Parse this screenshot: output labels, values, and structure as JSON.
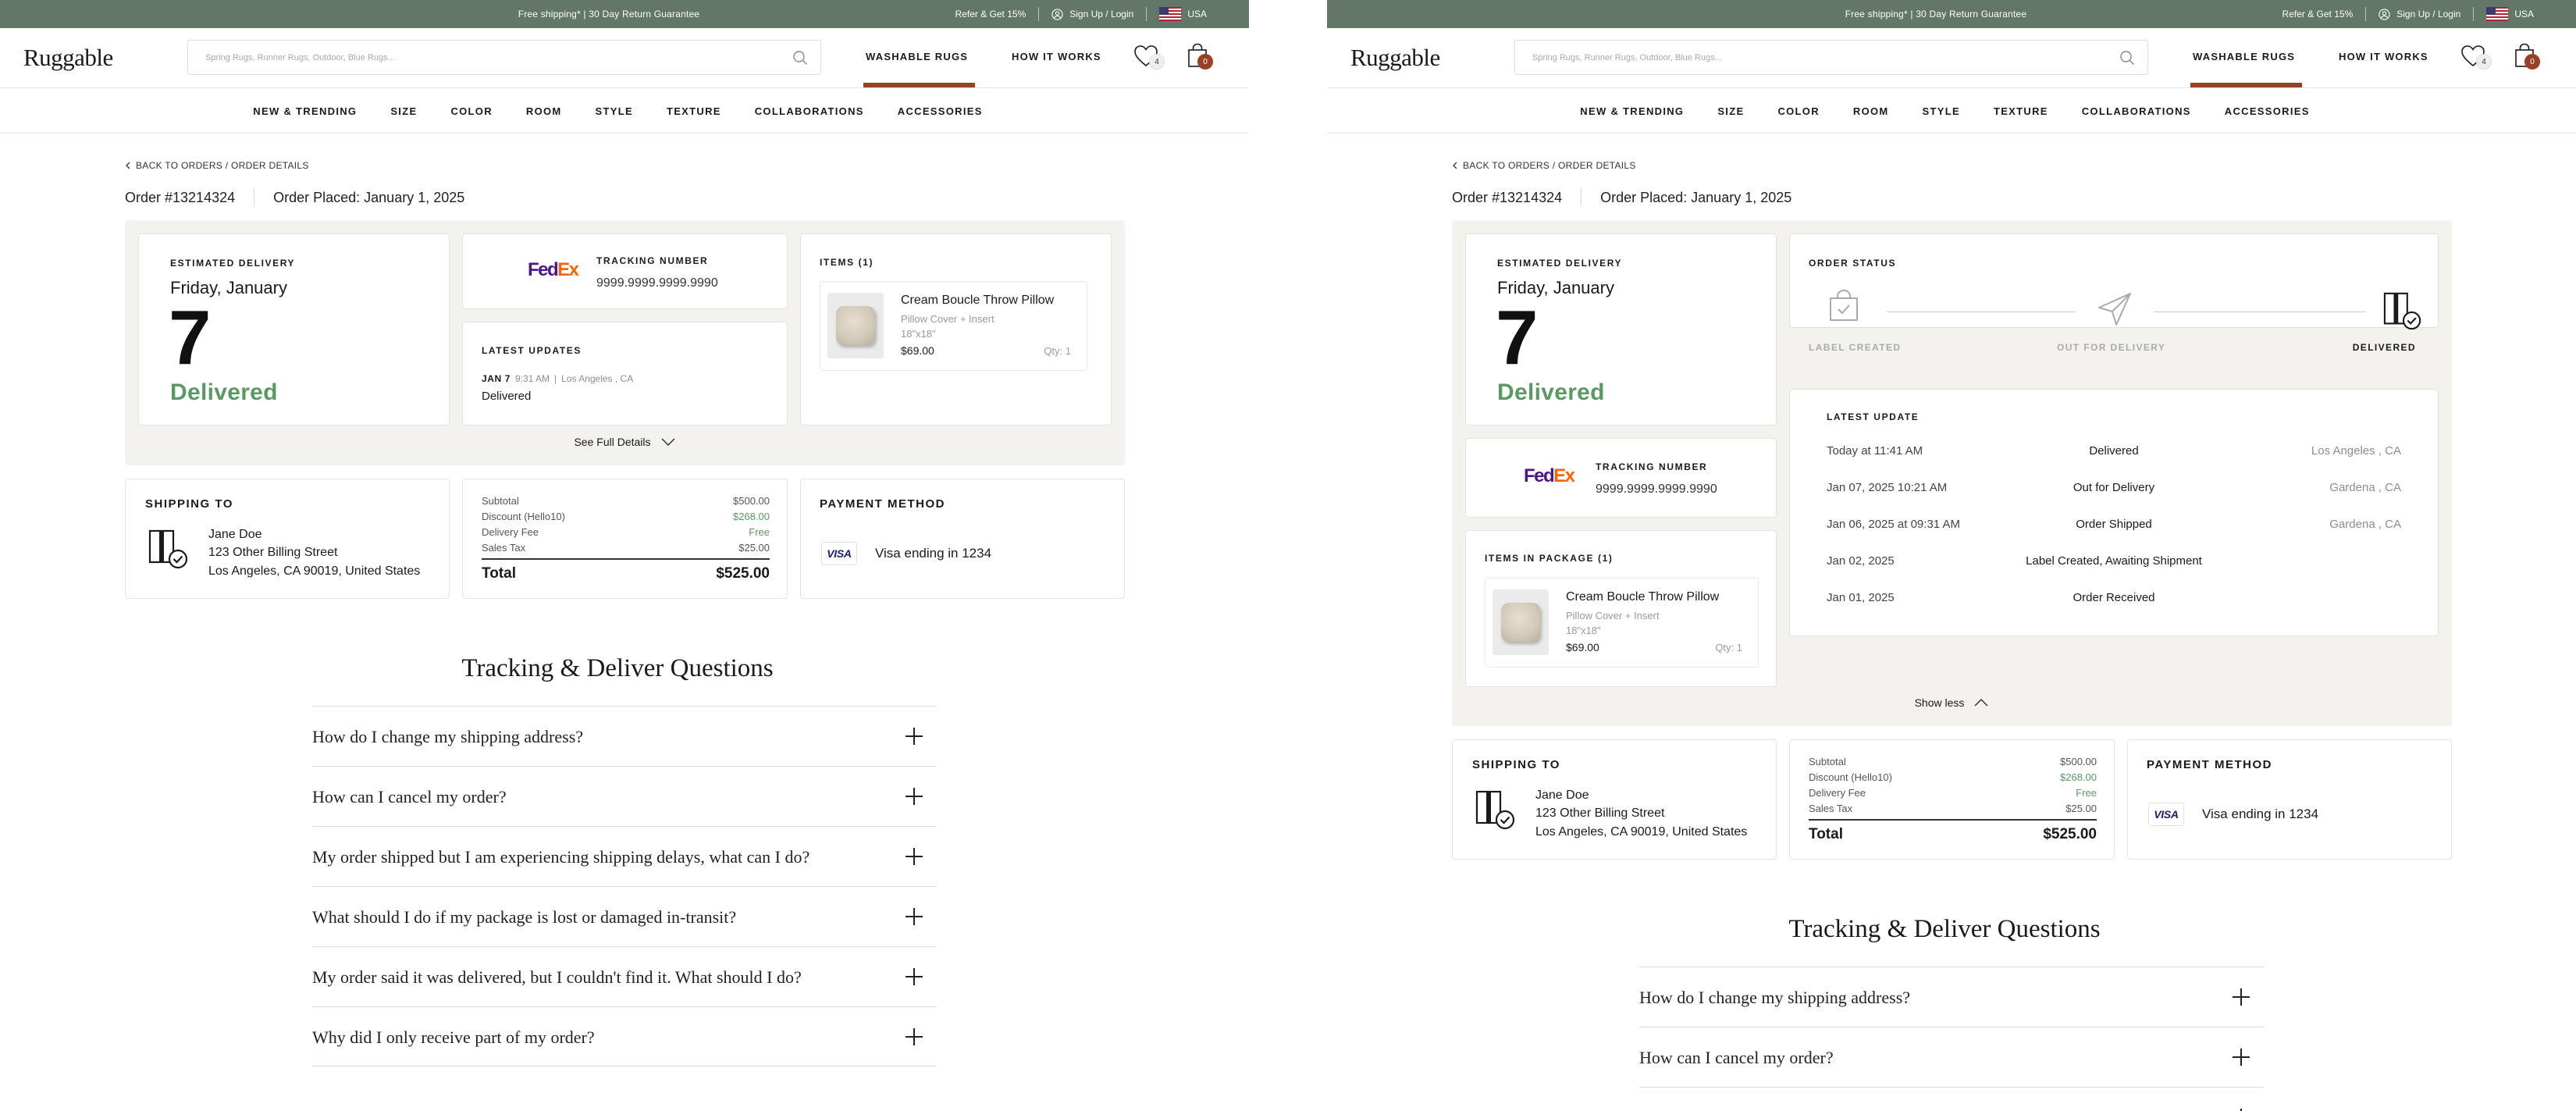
{
  "topbar": {
    "promo": "Free shipping* | 30 Day Return Guarantee",
    "refer": "Refer & Get 15%",
    "signup": "Sign Up / Login",
    "country": "USA"
  },
  "header": {
    "logo": "Ruggable",
    "search_placeholder": "Spring Rugs, Runner Rugs, Outdoor, Blue Rugs...",
    "washable": "WASHABLE RUGS",
    "how": "HOW IT WORKS",
    "wishlist_count": "4",
    "cart_count": "0",
    "accent": "#9a4125"
  },
  "catnav": [
    "NEW & TRENDING",
    "SIZE",
    "COLOR",
    "ROOM",
    "STYLE",
    "TEXTURE",
    "COLLABORATIONS",
    "ACCESSORIES"
  ],
  "order": {
    "back": "BACK TO ORDERS / ORDER DETAILS",
    "number": "Order #13214324",
    "placed": "Order Placed: January 1, 2025"
  },
  "delivery": {
    "label": "ESTIMATED DELIVERY",
    "day": "Friday, January",
    "date": "7",
    "status": "Delivered",
    "status_color": "#5a9a62"
  },
  "tracking": {
    "label": "TRACKING NUMBER",
    "number": "9999.9999.9999.9990",
    "carrier_fe": "Fed",
    "carrier_ex": "Ex"
  },
  "latest": {
    "label": "LATEST UPDATES",
    "date": "JAN 7",
    "time": "9:31 AM",
    "location": "Los Angeles , CA",
    "status": "Delivered"
  },
  "items": {
    "label": "ITEMS (1)",
    "label_pkg": "ITEMS IN PACKAGE (1)",
    "name": "Cream Boucle Throw Pillow",
    "variant": "Pillow Cover + Insert",
    "size": "18\"x18\"",
    "price": "$69.00",
    "qty": "Qty: 1"
  },
  "see_full": "See Full Details",
  "show_less": "Show less",
  "shipping": {
    "label": "SHIPPING TO",
    "name": "Jane Doe",
    "street": "123 Other Billing Street",
    "city": "Los Angeles, CA 90019, United States"
  },
  "totals": {
    "subtotal_l": "Subtotal",
    "subtotal_v": "$500.00",
    "discount_l": "Discount (Hello10)",
    "discount_v": "$268.00",
    "delivery_l": "Delivery Fee",
    "delivery_v": "Free",
    "tax_l": "Sales Tax",
    "tax_v": "$25.00",
    "total_l": "Total",
    "total_v": "$525.00",
    "green": "#5a9a62"
  },
  "payment": {
    "label": "PAYMENT METHOD",
    "brand": "VISA",
    "text": "Visa ending in 1234"
  },
  "order_status": {
    "label": "ORDER STATUS",
    "steps": [
      "LABEL CREATED",
      "OUT FOR DELIVERY",
      "DELIVERED"
    ]
  },
  "latest_update": {
    "label": "LATEST UPDATE",
    "rows": [
      {
        "time": "Today at 11:41 AM",
        "status": "Delivered",
        "loc": "Los Angeles , CA"
      },
      {
        "time": "Jan 07, 2025 10:21 AM",
        "status": "Out for Delivery",
        "loc": "Gardena , CA"
      },
      {
        "time": "Jan 06, 2025 at 09:31 AM",
        "status": "Order Shipped",
        "loc": "Gardena , CA"
      },
      {
        "time": "Jan 02, 2025",
        "status": "Label Created, Awaiting Shipment",
        "loc": ""
      },
      {
        "time": "Jan 01, 2025",
        "status": "Order Received",
        "loc": ""
      }
    ]
  },
  "faq": {
    "title": "Tracking & Deliver Questions",
    "questions": [
      "How do I change my shipping address?",
      "How can I cancel my order?",
      "My order shipped but I am experiencing shipping delays, what can I do?",
      "What should I do if my package is lost or damaged in-transit?",
      "My order said it was delivered, but I couldn't find it. What should I do?",
      "Why did I only receive part of my order?"
    ]
  }
}
